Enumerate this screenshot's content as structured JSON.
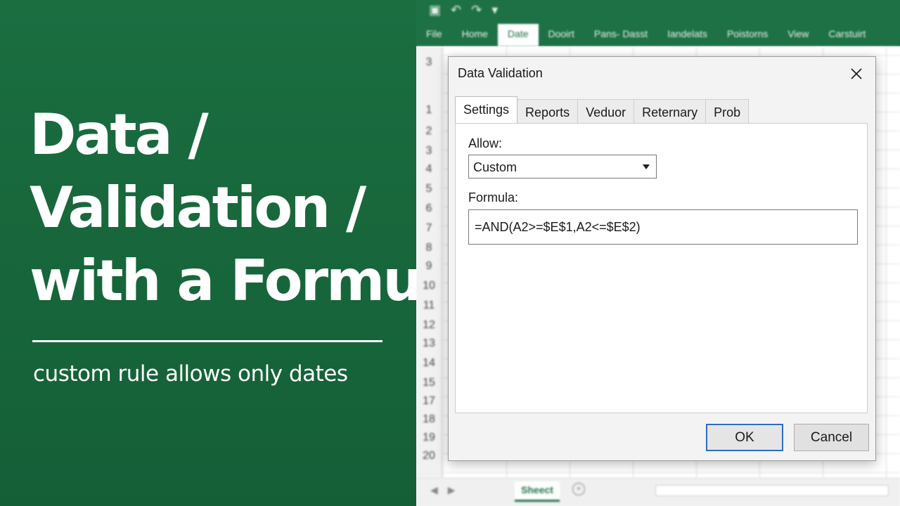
{
  "thumbnail": {
    "title_lines": [
      "Data /",
      "Validation /",
      "with a Formula"
    ],
    "subtitle": "custom rule allows only dates",
    "accent_color": "#17683c"
  },
  "excel": {
    "ribbon_tabs": [
      "File",
      "Home",
      "Date",
      "Dooirt",
      "Pans- Dasst",
      "Iandelats",
      "Poistorns",
      "View",
      "Carstuirt"
    ],
    "active_ribbon_tab": "Date",
    "row_numbers": [
      "3",
      "",
      "1",
      "2",
      "3",
      "4",
      "5",
      "6",
      "7",
      "8",
      "9",
      "10",
      "11",
      "12",
      "13",
      "14",
      "15",
      "17",
      "18",
      "19",
      "20"
    ],
    "sheet_tab": "Sheect",
    "ribbon_color": "#1e7145"
  },
  "dialog": {
    "title": "Data Validation",
    "tabs": [
      "Settings",
      "Reports",
      "Veduor",
      "Reternary",
      "Prob"
    ],
    "active_tab": "Settings",
    "allow_label": "Allow:",
    "allow_value": "Custom",
    "formula_label": "Formula:",
    "formula_value": "=AND(A2>=$E$1,A2<=$E$2)",
    "ok_label": "OK",
    "cancel_label": "Cancel",
    "focus_color": "#2b6fbf"
  }
}
